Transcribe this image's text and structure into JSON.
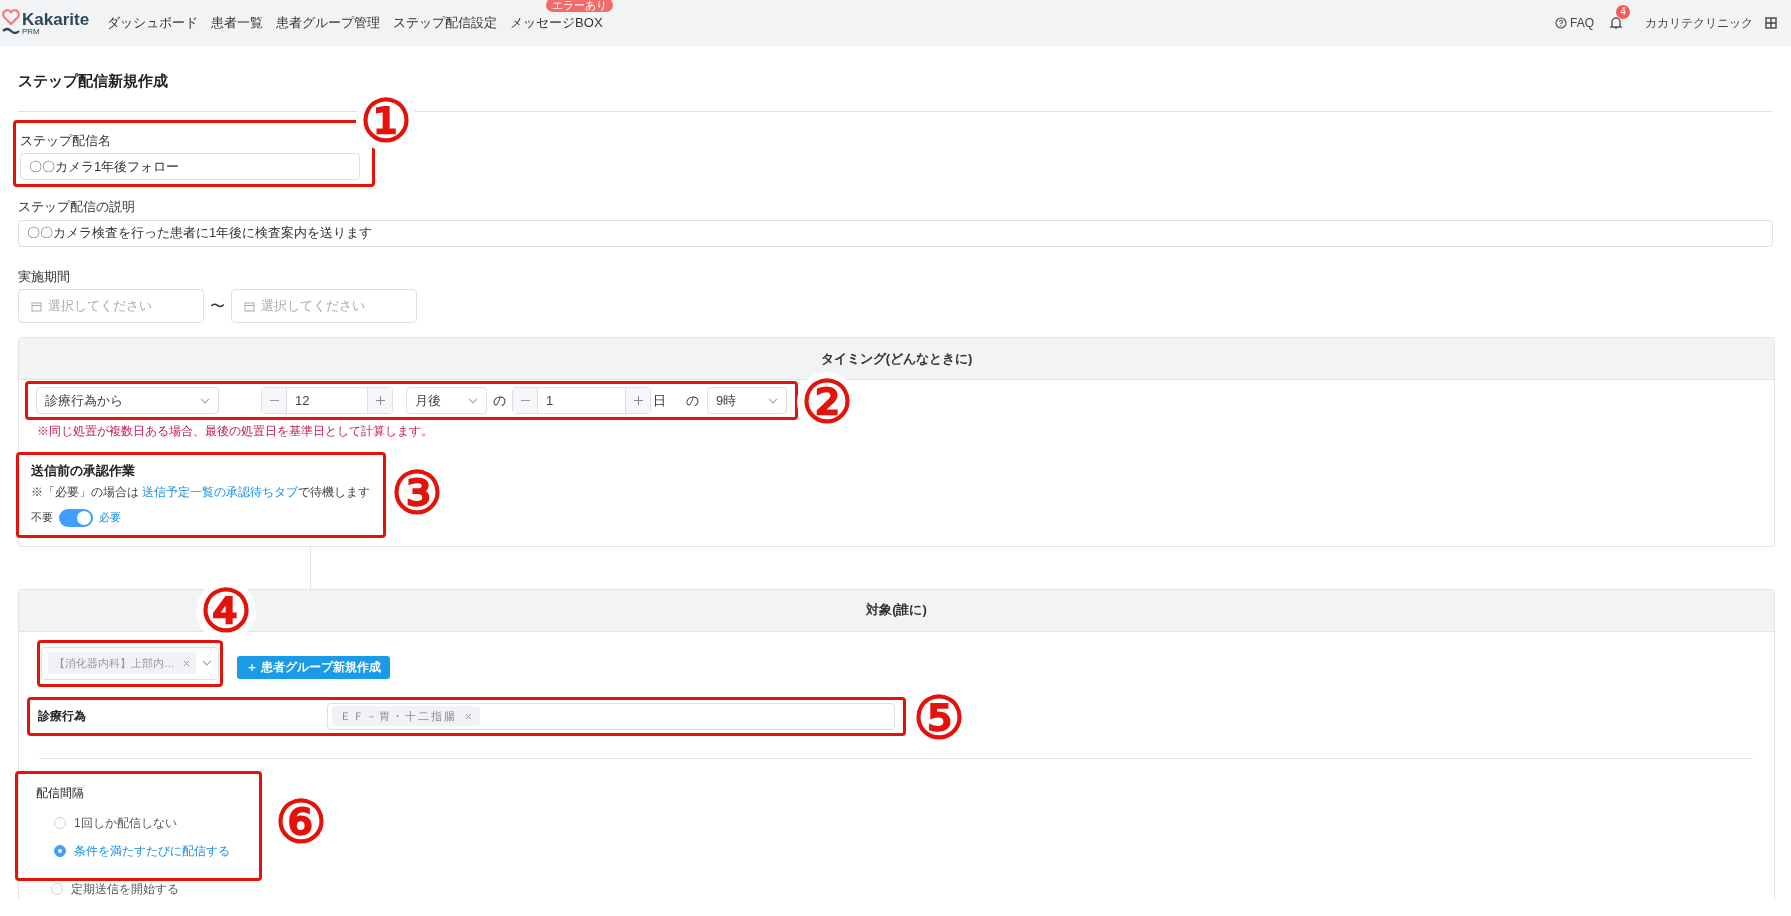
{
  "header": {
    "logo": "Kakarite",
    "logo_sub": "PRM",
    "nav": [
      {
        "label": "ダッシュボード"
      },
      {
        "label": "患者一覧"
      },
      {
        "label": "患者グループ管理"
      },
      {
        "label": "ステップ配信設定"
      },
      {
        "label": "メッセージBOX",
        "badge": "エラーあり"
      }
    ],
    "faq": "FAQ",
    "notification_count": "4",
    "clinic": "カカリテクリニック"
  },
  "page_title": "ステップ配信新規作成",
  "name_field": {
    "label": "ステップ配信名",
    "value": "〇〇カメラ1年後フォロー",
    "annotation": "①"
  },
  "description_field": {
    "label": "ステップ配信の説明",
    "value": "〇〇カメラ検査を行った患者に1年後に検査案内を送ります"
  },
  "period": {
    "label": "実施期間",
    "start_placeholder": "選択してください",
    "separator": "〜",
    "end_placeholder": "選択してください"
  },
  "timing": {
    "title": "タイミング(どんなときに)",
    "annotation": "②",
    "base": "診療行為から",
    "months": "12",
    "month_unit": "月後",
    "of1": "の",
    "days": "1",
    "day_unit": "日",
    "of2": "の",
    "hour": "9時",
    "note": "※同じ処置が複数日ある場合、最後の処置日を基準日として計算します。",
    "approval": {
      "annotation": "③",
      "title": "送信前の承認作業",
      "note": "※「必要」の場合は ",
      "link": "送信予定一覧の承認待ちタブ",
      "note_end": "で待機します",
      "off_label": "不要",
      "on_label": "必要",
      "on": true
    }
  },
  "target": {
    "title": "対象(誰に)",
    "group_annotation": "④",
    "group_tag": "【消化器内科】上部内…",
    "new_group_button": "＋ 患者グループ新規作成",
    "treatment_annotation": "⑤",
    "treatment_label": "診療行為",
    "treatment_tag": "ＥＦ－胃・十二指腸",
    "interval": {
      "annotation": "⑥",
      "label": "配信間隔",
      "options": [
        {
          "label": "1回しか配信しない",
          "selected": false
        },
        {
          "label": "条件を満たすたびに配信する",
          "selected": true
        }
      ]
    },
    "periodic": {
      "label": "定期送信を開始する",
      "selected": false
    }
  }
}
